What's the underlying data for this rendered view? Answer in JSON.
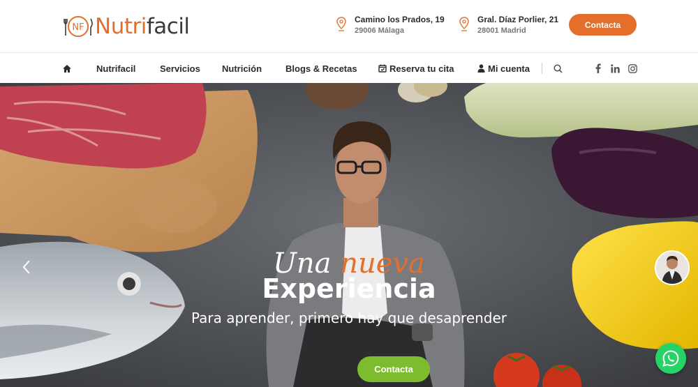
{
  "brand": {
    "name_part1": "Nutri",
    "name_part2": "facil",
    "mark_text": "NF",
    "accent_color": "#e36f2a",
    "green_color": "#7dbb2f"
  },
  "addresses": [
    {
      "line1": "Camino los Prados, 19",
      "line2": "29006 Málaga",
      "icon": "map-pin-icon"
    },
    {
      "line1": "Gral. Díaz Porlier, 21",
      "line2": "28001 Madrid",
      "icon": "map-pin-icon"
    }
  ],
  "header": {
    "contact_label": "Contacta"
  },
  "nav": {
    "home_icon": "home-icon",
    "items": [
      {
        "label": "Nutrifacil"
      },
      {
        "label": "Servicios"
      },
      {
        "label": "Nutrición"
      },
      {
        "label": "Blogs & Recetas"
      },
      {
        "label": "Reserva tu cita",
        "icon": "calendar-icon"
      },
      {
        "label": "Mi cuenta",
        "icon": "user-icon"
      }
    ],
    "search_icon": "search-icon",
    "social": [
      "facebook-icon",
      "linkedin-icon",
      "instagram-icon"
    ]
  },
  "hero": {
    "title_word1": "Una",
    "title_word2": "nueva",
    "title_line2": "Experiencia",
    "subtitle": "Para aprender, primero hay que desaprender",
    "cta_label": "Contacta"
  },
  "widgets": {
    "whatsapp_icon": "whatsapp-icon",
    "avatar": "avatar"
  }
}
